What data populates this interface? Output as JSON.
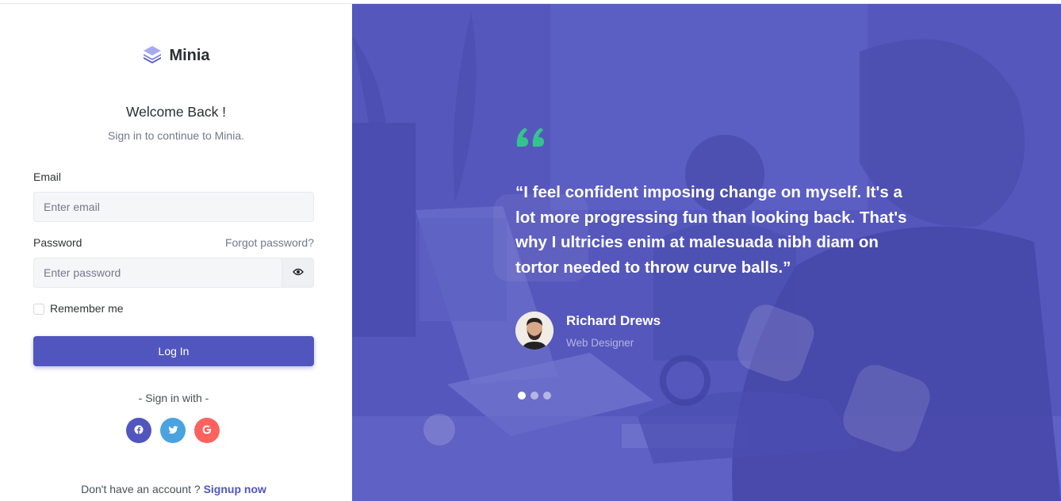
{
  "brand": {
    "name": "Minia",
    "logo_icon": "layers-icon"
  },
  "login": {
    "title": "Welcome Back !",
    "subtitle": "Sign in to continue to Minia.",
    "email_label": "Email",
    "email_placeholder": "Enter email",
    "password_label": "Password",
    "forgot_password": "Forgot password?",
    "password_placeholder": "Enter password",
    "password_toggle_icon": "eye-icon",
    "remember_label": "Remember me",
    "remember_checked": false,
    "login_button": "Log In",
    "signin_with": "- Sign in with -",
    "social": [
      {
        "name": "facebook-icon",
        "color": "#5156be"
      },
      {
        "name": "twitter-icon",
        "color": "#4aa3df"
      },
      {
        "name": "google-icon",
        "color": "#fd625e"
      }
    ],
    "signup_prompt": "Don't have an account ?",
    "signup_link": "Signup now"
  },
  "testimonial": {
    "quote_icon": "quote-icon",
    "quote": "“I feel confident imposing change on myself. It's a lot more progressing fun than looking back. That's why I ultricies enim at malesuada nibh diam on tortor needed to throw curve balls.”",
    "author_name": "Richard Drews",
    "author_role": "Web Designer",
    "slides_total": 3,
    "active_slide": 1
  },
  "colors": {
    "primary": "#5156be",
    "overlay": "#5557bd",
    "quote_mark": "#34c38f"
  }
}
